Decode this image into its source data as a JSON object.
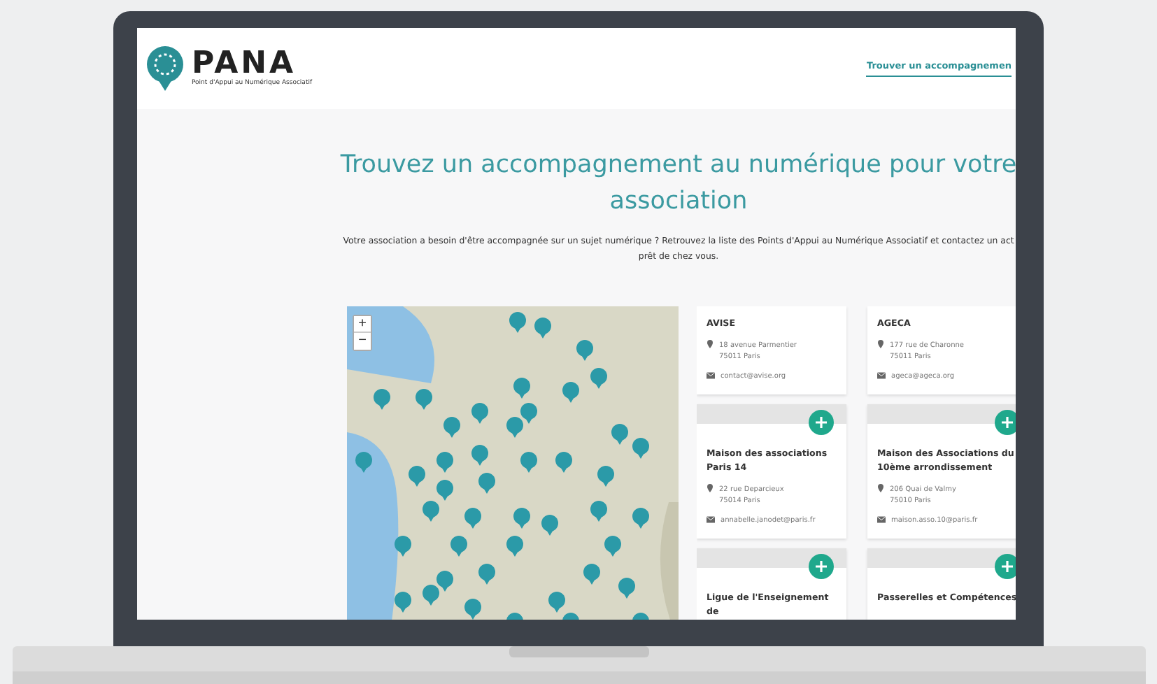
{
  "header": {
    "logo_name": "PANA",
    "logo_tagline": "Point d'Appui au Numérique Associatif",
    "nav_link": "Trouver un accompagnemen"
  },
  "hero": {
    "title": "Trouvez un accompagnement au numérique pour votre association",
    "intro": "Votre association a besoin d'être accompagnée sur un sujet numérique ? Retrouvez la liste des Points d'Appui au Numérique Associatif et contactez un act",
    "intro_line2": "prêt de chez vous."
  },
  "map": {
    "zoom_in": "+",
    "zoom_out": "−"
  },
  "cards": [
    {
      "name": "AVISE",
      "address": [
        "18 avenue Parmentier",
        "75011 Paris"
      ],
      "email": "contact@avise.org",
      "header_band": false
    },
    {
      "name": "AGECA",
      "address": [
        "177 rue de Charonne",
        "75011 Paris"
      ],
      "email": "ageca@ageca.org",
      "header_band": false
    },
    {
      "name": "Maison des associations Paris 14",
      "address": [
        "22 rue Deparcieux",
        "75014 Paris"
      ],
      "email": "annabelle.janodet@paris.fr",
      "header_band": true
    },
    {
      "name": "Maison des Associations du 10ème arrondissement",
      "address": [
        "206 Quai de Valmy",
        "75010 Paris"
      ],
      "email": "maison.asso.10@paris.fr",
      "header_band": true
    },
    {
      "name": "Ligue de l'Enseignement de",
      "header_band": true
    },
    {
      "name": "Passerelles et Compétences",
      "header_band": true
    }
  ]
}
